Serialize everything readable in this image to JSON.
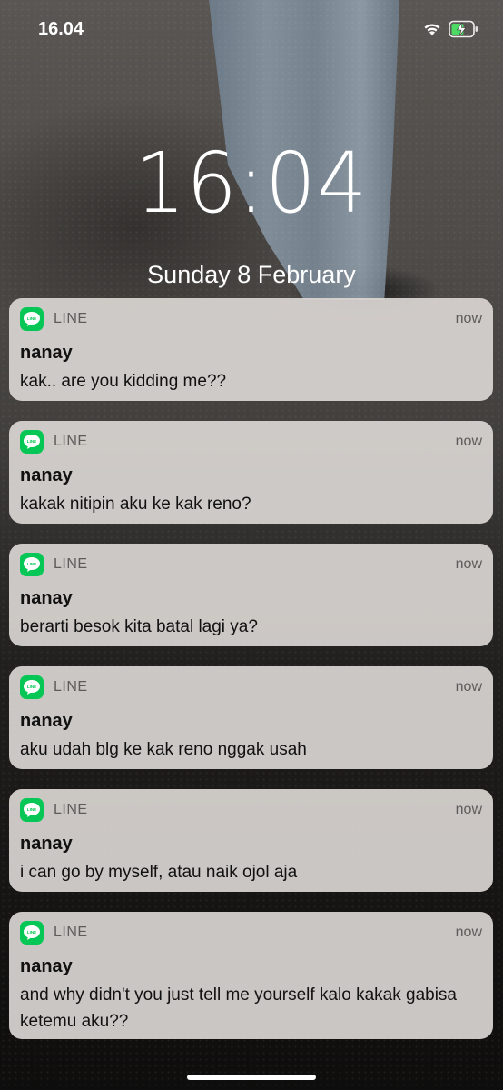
{
  "status_bar": {
    "time": "16.04"
  },
  "lock_screen": {
    "time": "16:04",
    "date": "Sunday 8 February"
  },
  "notifications": [
    {
      "app": "LINE",
      "time": "now",
      "sender": "nanay",
      "message": "kak.. are you kidding me??"
    },
    {
      "app": "LINE",
      "time": "now",
      "sender": "nanay",
      "message": "kakak nitipin aku ke kak reno?"
    },
    {
      "app": "LINE",
      "time": "now",
      "sender": "nanay",
      "message": "berarti besok kita batal lagi ya?"
    },
    {
      "app": "LINE",
      "time": "now",
      "sender": "nanay",
      "message": "aku udah blg ke kak reno nggak usah"
    },
    {
      "app": "LINE",
      "time": "now",
      "sender": "nanay",
      "message": "i can go by myself, atau naik ojol aja"
    },
    {
      "app": "LINE",
      "time": "now",
      "sender": "nanay",
      "message": "and why didn't you just tell me yourself kalo kakak gabisa ketemu aku??"
    }
  ],
  "app_icon_text": "LINE",
  "colors": {
    "line_green": "#06c755",
    "notification_bg": "#dad6d2"
  }
}
